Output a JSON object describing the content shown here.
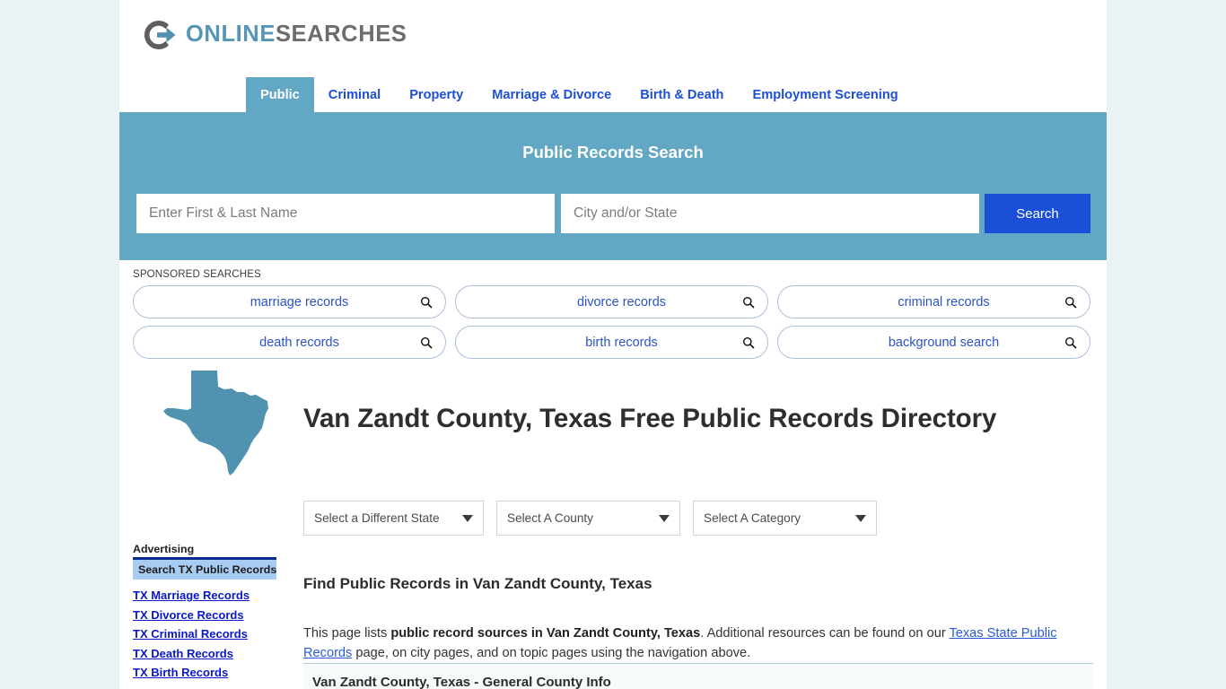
{
  "brand": {
    "logo_icon": "circle-arrow-logo-icon",
    "name_part1": "ONLINE",
    "name_part2": "SEARCHES",
    "color_primary": "#5696b4",
    "color_secondary": "#6d6d6d"
  },
  "nav": {
    "tabs": [
      {
        "label": "Public",
        "active": true
      },
      {
        "label": "Criminal",
        "active": false
      },
      {
        "label": "Property",
        "active": false
      },
      {
        "label": "Marriage & Divorce",
        "active": false
      },
      {
        "label": "Birth & Death",
        "active": false
      },
      {
        "label": "Employment Screening",
        "active": false
      }
    ],
    "active_bg": "#62a8c4",
    "link_color": "#1d4ed8"
  },
  "search": {
    "title": "Public Records Search",
    "name_placeholder": "Enter First & Last Name",
    "name_value": "",
    "city_placeholder": "City and/or State",
    "city_value": "",
    "button_label": "Search",
    "band_color": "#62a8c4",
    "button_color": "#1b4fd8"
  },
  "sponsored": {
    "label": "SPONSORED SEARCHES",
    "items": [
      {
        "label": "marriage records",
        "icon": "search-icon"
      },
      {
        "label": "divorce records",
        "icon": "search-icon"
      },
      {
        "label": "criminal records",
        "icon": "search-icon"
      },
      {
        "label": "death records",
        "icon": "search-icon"
      },
      {
        "label": "birth records",
        "icon": "search-icon"
      },
      {
        "label": "background search",
        "icon": "search-icon"
      }
    ]
  },
  "hero": {
    "map_icon": "texas-state-map-icon",
    "map_color": "#4f93b0",
    "title": "Van Zandt County, Texas Free Public Records Directory"
  },
  "filters": {
    "state": "Select a Different State",
    "county": "Select A County",
    "category": "Select A Category"
  },
  "main": {
    "section_heading": "Find Public Records in Van Zandt County, Texas",
    "paragraph": {
      "part1": "This page lists ",
      "bold1": "public record sources in Van Zandt County, Texas",
      "part2": ". Additional resources can be found on our ",
      "link": "Texas State Public Records",
      "part3": " page, on city pages, and on topic pages using the navigation above."
    },
    "info_strip_title": "Van Zandt County, Texas - General County Info"
  },
  "sidebar": {
    "ad_label": "Advertising",
    "ad_header": "Search TX Public Records",
    "links": [
      "TX Marriage Records",
      "TX Divorce Records",
      "TX Criminal Records",
      "TX Death Records",
      "TX Birth Records"
    ]
  }
}
